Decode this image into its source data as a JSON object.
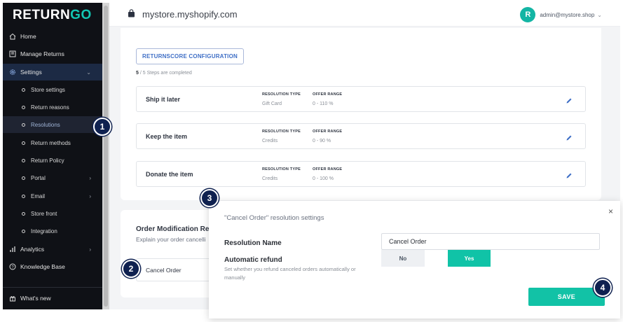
{
  "app": {
    "logo_main": "RETURN",
    "logo_accent": "GO"
  },
  "sidebar": {
    "items": [
      {
        "label": "Home",
        "icon": "home-icon"
      },
      {
        "label": "Manage Returns",
        "icon": "returns-icon"
      },
      {
        "label": "Settings",
        "icon": "gear-icon"
      },
      {
        "label": "Analytics",
        "icon": "bar-chart-icon"
      },
      {
        "label": "Knowledge Base",
        "icon": "help-icon"
      },
      {
        "label": "What's new",
        "icon": "gift-icon"
      }
    ],
    "settings_sub": [
      {
        "label": "Store settings"
      },
      {
        "label": "Return reasons"
      },
      {
        "label": "Resolutions"
      },
      {
        "label": "Return methods"
      },
      {
        "label": "Return Policy"
      },
      {
        "label": "Portal"
      },
      {
        "label": "Email"
      },
      {
        "label": "Store front"
      },
      {
        "label": "Integration"
      }
    ]
  },
  "topbar": {
    "store_url": "mystore.myshopify.com",
    "user_email": "admin@mystore.shop",
    "avatar_letter": "R"
  },
  "main": {
    "returnscore_button": "RETURNSCORE CONFIGURATION",
    "steps_done": "5",
    "steps_text": " / 5 Steps are completed",
    "col_type": "RESOLUTION TYPE",
    "col_range": "OFFER RANGE",
    "resolutions": [
      {
        "name": "Ship it later",
        "type": "Gift Card",
        "range": "0 - 110 %"
      },
      {
        "name": "Keep the item",
        "type": "Credits",
        "range": "0 - 90 %"
      },
      {
        "name": "Donate the item",
        "type": "Credits",
        "range": "0 - 100 %"
      }
    ],
    "order_mod_title": "Order Modification Res",
    "order_mod_desc": "Explain your order cancelli",
    "cancel_order_label": "Cancel Order"
  },
  "modal": {
    "title": "\"Cancel Order\" resolution settings",
    "close": "×",
    "resolution_name_label": "Resolution Name",
    "resolution_name_value": "Cancel Order",
    "auto_refund_label": "Automatic refund",
    "auto_refund_help": "Set whether you refund canceled orders automatically or manually",
    "no_label": "No",
    "yes_label": "Yes",
    "save_label": "SAVE"
  },
  "badges": [
    "1",
    "2",
    "3",
    "4"
  ],
  "colors": {
    "accent": "#12c2a6",
    "sidebar_bg": "#0f1116",
    "badge_bg": "#0f2150",
    "link_blue": "#3f6fc6"
  }
}
